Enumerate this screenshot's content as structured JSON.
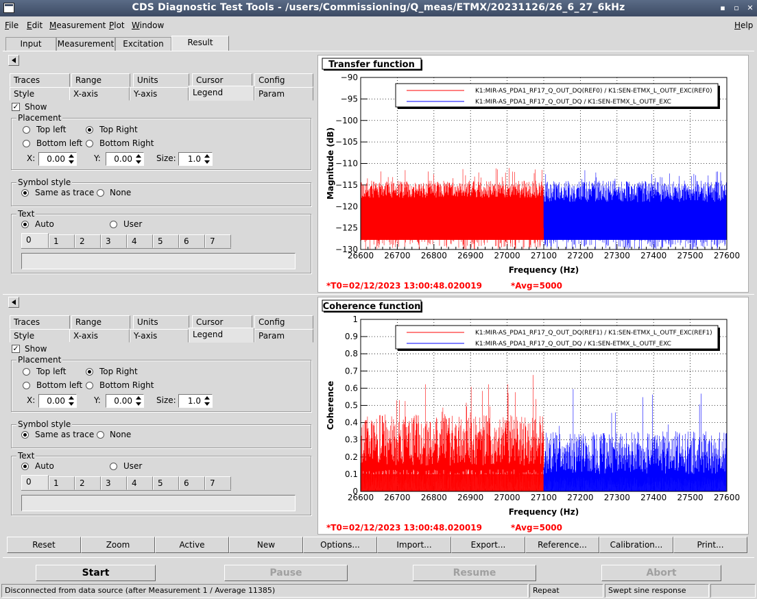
{
  "window": {
    "title": "CDS Diagnostic Test Tools - /users/Commissioning/Q_meas/ETMX/20231126/26_6_27_6kHz",
    "controls": {
      "minimize": "▪",
      "maximize": "▫",
      "close": "✕"
    }
  },
  "menu": {
    "items": [
      "File",
      "Edit",
      "Measurement",
      "Plot",
      "Window"
    ],
    "help": "Help"
  },
  "main_tabs": {
    "items": [
      "Input",
      "Measurement",
      "Excitation",
      "Result"
    ],
    "selected": 3
  },
  "options_panel": {
    "tabs_row1": [
      "Traces",
      "Range",
      "Units",
      "Cursor",
      "Config"
    ],
    "tabs_row2": [
      "Style",
      "X-axis",
      "Y-axis",
      "Legend",
      "Param"
    ],
    "selected_tab": "Legend",
    "show_label": "Show",
    "show_checked": true,
    "placement": {
      "title": "Placement",
      "options": [
        "Top left",
        "Top Right",
        "Bottom left",
        "Bottom Right"
      ],
      "selected": "Top Right",
      "x_label": "X:",
      "x_value": "0.00",
      "y_label": "Y:",
      "y_value": "0.00",
      "size_label": "Size:",
      "size_value": "1.0"
    },
    "symbol_style": {
      "title": "Symbol style",
      "options": [
        "Same as trace",
        "None"
      ],
      "selected": "Same as trace"
    },
    "text": {
      "title": "Text",
      "options": [
        "Auto",
        "User"
      ],
      "selected": "Auto",
      "trace_tabs": [
        "0",
        "1",
        "2",
        "3",
        "4",
        "5",
        "6",
        "7"
      ],
      "field_value": ""
    }
  },
  "colors": {
    "ref_trace": "#ff0000",
    "live_trace": "#0000ff",
    "info_text": "#ff0000"
  },
  "plots": [
    {
      "title": "Transfer function",
      "info_t0": "*T0=02/12/2023 13:00:48.020019",
      "info_avg": "*Avg=5000",
      "legend": [
        "K1:MIR-AS_PDA1_RF17_Q_OUT_DQ(REF0) / K1:SEN-ETMX_L_OUTF_EXC(REF0)",
        "K1:MIR-AS_PDA1_RF17_Q_OUT_DQ / K1:SEN-ETMX_L_OUTF_EXC"
      ],
      "chart_data": {
        "type": "line",
        "xlabel": "Frequency (Hz)",
        "ylabel": "Magnitude (dB)",
        "xlim": [
          26600,
          27600
        ],
        "ylim": [
          -130,
          -90
        ],
        "xticks": [
          "26600",
          "26700",
          "26800",
          "26900",
          "27000",
          "27100",
          "27200",
          "27300",
          "27400",
          "27500",
          "27600"
        ],
        "yticks": [
          "−130",
          "−125",
          "−120",
          "−115",
          "−110",
          "−105",
          "−100",
          "−95",
          "−90"
        ],
        "grid": true,
        "legend_position": "top-right",
        "series": [
          {
            "name": "K1:MIR-AS_PDA1_RF17_Q_OUT_DQ(REF0) / K1:SEN-ETMX_L_OUTF_EXC(REF0)",
            "x_range": [
              26600,
              27100
            ],
            "noise_floor": -130,
            "typical_peak": [
              -118,
              -114
            ],
            "max_peak": -111,
            "color": "#ff0000"
          },
          {
            "name": "K1:MIR-AS_PDA1_RF17_Q_OUT_DQ / K1:SEN-ETMX_L_OUTF_EXC",
            "x_range": [
              27100,
              27600
            ],
            "noise_floor": -130,
            "typical_peak": [
              -119,
              -114
            ],
            "max_peak": -111.5,
            "color": "#0000ff"
          }
        ]
      }
    },
    {
      "title": "Coherence function",
      "info_t0": "*T0=02/12/2023 13:00:48.020019",
      "info_avg": "*Avg=5000",
      "legend": [
        "K1:MIR-AS_PDA1_RF17_Q_OUT_DQ(REF1) / K1:SEN-ETMX_L_OUTF_EXC(REF1)",
        "K1:MIR-AS_PDA1_RF17_Q_OUT_DQ / K1:SEN-ETMX_L_OUTF_EXC"
      ],
      "chart_data": {
        "type": "line",
        "xlabel": "Frequency (Hz)",
        "ylabel": "Coherence",
        "xlim": [
          26600,
          27600
        ],
        "ylim": [
          0,
          1
        ],
        "xticks": [
          "26600",
          "26700",
          "26800",
          "26900",
          "27000",
          "27100",
          "27200",
          "27300",
          "27400",
          "27500",
          "27600"
        ],
        "yticks": [
          "0",
          "0.1",
          "0.2",
          "0.3",
          "0.4",
          "0.5",
          "0.6",
          "0.7",
          "0.8",
          "0.9",
          "1"
        ],
        "grid": true,
        "legend_position": "top-right",
        "series": [
          {
            "name": "K1:MIR-AS_PDA1_RF17_Q_OUT_DQ(REF1) / K1:SEN-ETMX_L_OUTF_EXC(REF1)",
            "x_range": [
              26600,
              27100
            ],
            "noise_floor": 0,
            "typical_peak": [
              0.15,
              0.45
            ],
            "max_peak": 0.7,
            "color": "#ff0000"
          },
          {
            "name": "K1:MIR-AS_PDA1_RF17_Q_OUT_DQ / K1:SEN-ETMX_L_OUTF_EXC",
            "x_range": [
              27100,
              27600
            ],
            "noise_floor": 0,
            "typical_peak": [
              0.1,
              0.35
            ],
            "max_peak": 0.61,
            "color": "#0000ff"
          }
        ]
      }
    }
  ],
  "bottom_buttons": [
    "Reset",
    "Zoom",
    "Active",
    "New",
    "Options...",
    "Import...",
    "Export...",
    "Reference...",
    "Calibration...",
    "Print..."
  ],
  "control_buttons": {
    "start": "Start",
    "pause": "Pause",
    "resume": "Resume",
    "abort": "Abort"
  },
  "statusbar": {
    "message": "Disconnected from data source (after Measurement 1 / Average 11385)",
    "mode": "Repeat",
    "type": "Swept sine response"
  }
}
